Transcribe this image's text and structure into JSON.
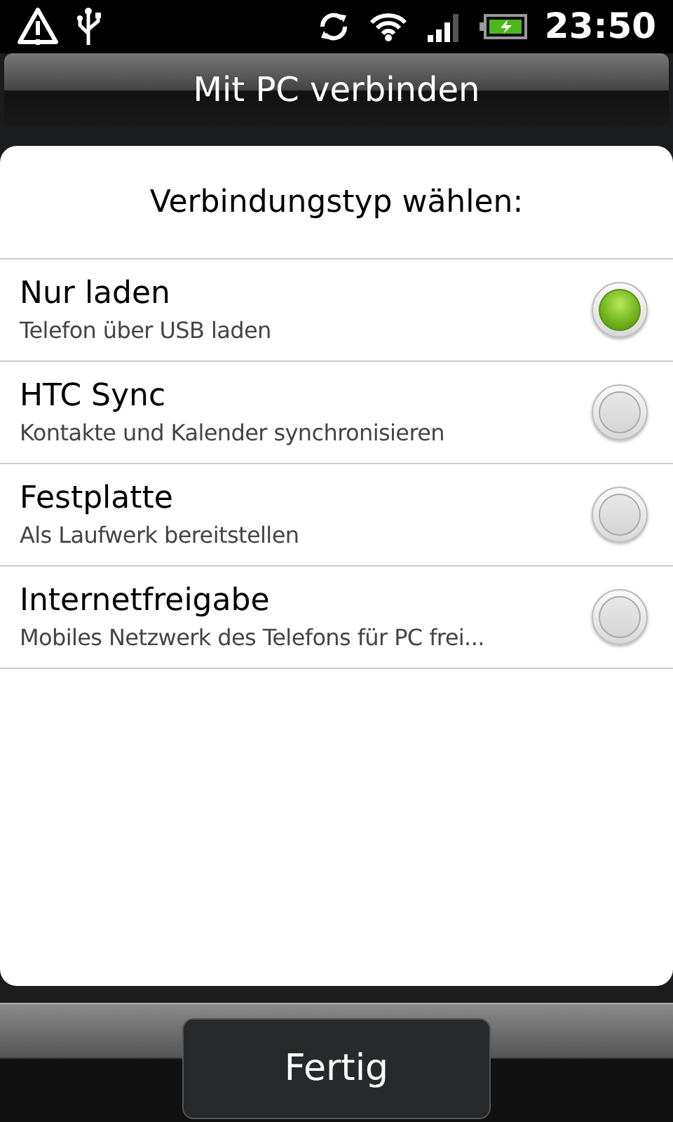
{
  "status_bar": {
    "time": "23:50"
  },
  "title_bar": {
    "title": "Mit PC verbinden"
  },
  "dialog": {
    "heading": "Verbindungstyp wählen:",
    "options": [
      {
        "label": "Nur laden",
        "description": "Telefon über USB laden",
        "selected": true
      },
      {
        "label": "HTC Sync",
        "description": "Kontakte und Kalender synchronisieren",
        "selected": false
      },
      {
        "label": "Festplatte",
        "description": "Als Laufwerk bereitstellen",
        "selected": false
      },
      {
        "label": "Internetfreigabe",
        "description": "Mobiles Netzwerk des Telefons für PC frei...",
        "selected": false
      }
    ]
  },
  "buttons": [
    "Fertig"
  ]
}
